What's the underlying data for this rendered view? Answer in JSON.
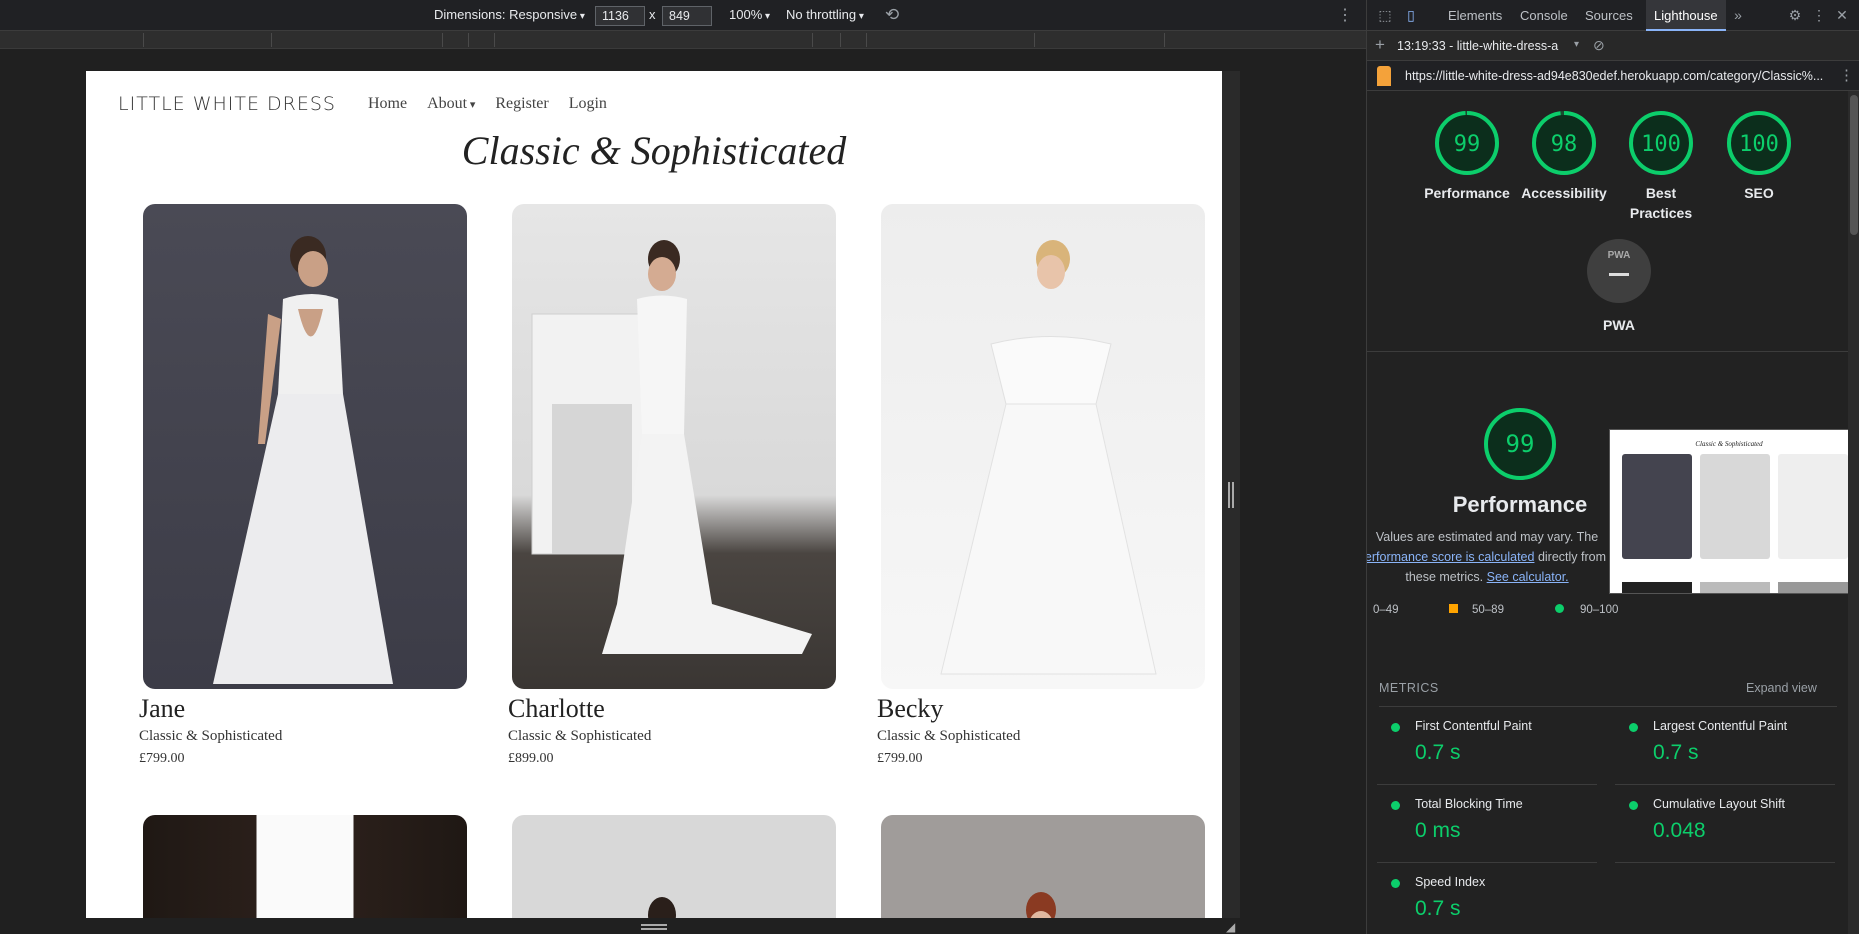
{
  "device_toolbar": {
    "dimensions_label": "Dimensions: Responsive",
    "width_value": "1136",
    "times": "x",
    "height_value": "849",
    "zoom": "100%",
    "throttling": "No throttling"
  },
  "site": {
    "brand": "LITTLE WHITE DRESS",
    "nav": [
      "Home",
      "About",
      "Register",
      "Login"
    ],
    "heading": "Classic & Sophisticated",
    "products": [
      {
        "name": "Jane",
        "category": "Classic & Sophisticated",
        "price": "£799.00"
      },
      {
        "name": "Charlotte",
        "category": "Classic & Sophisticated",
        "price": "£899.00"
      },
      {
        "name": "Becky",
        "category": "Classic & Sophisticated",
        "price": "£799.00"
      }
    ]
  },
  "devtools": {
    "tabs": [
      "Elements",
      "Console",
      "Sources",
      "Lighthouse"
    ],
    "active_tab": "Lighthouse",
    "report_time": "13:19:33 - little-white-dress-a",
    "url": "https://little-white-dress-ad94e830edef.herokuapp.com/category/Classic%...",
    "scores": [
      {
        "label": "Performance",
        "value": 99
      },
      {
        "label": "Accessibility",
        "value": 98
      },
      {
        "label": "Best Practices",
        "value": 100
      },
      {
        "label": "SEO",
        "value": 100
      }
    ],
    "pwa_label": "PWA",
    "pwa_badge": "PWA",
    "performance": {
      "score": "99",
      "title": "Performance",
      "desc_1": "Values are estimated and may vary. The",
      "link_1": "performance score is calculated",
      "desc_2": "directly from",
      "desc_3": "these metrics.",
      "link_2": "See calculator."
    },
    "legend": [
      "0–49",
      "50–89",
      "90–100"
    ],
    "metrics_heading": "METRICS",
    "expand_view": "Expand view",
    "metrics": [
      {
        "label": "First Contentful Paint",
        "value": "0.7 s"
      },
      {
        "label": "Largest Contentful Paint",
        "value": "0.7 s"
      },
      {
        "label": "Total Blocking Time",
        "value": "0 ms"
      },
      {
        "label": "Cumulative Layout Shift",
        "value": "0.048"
      },
      {
        "label": "Speed Index",
        "value": "0.7 s"
      }
    ],
    "colors": {
      "pass": "#0cce6b",
      "average": "#ffa400",
      "fail": "#ff4e42",
      "link": "#8ab4f8"
    }
  }
}
